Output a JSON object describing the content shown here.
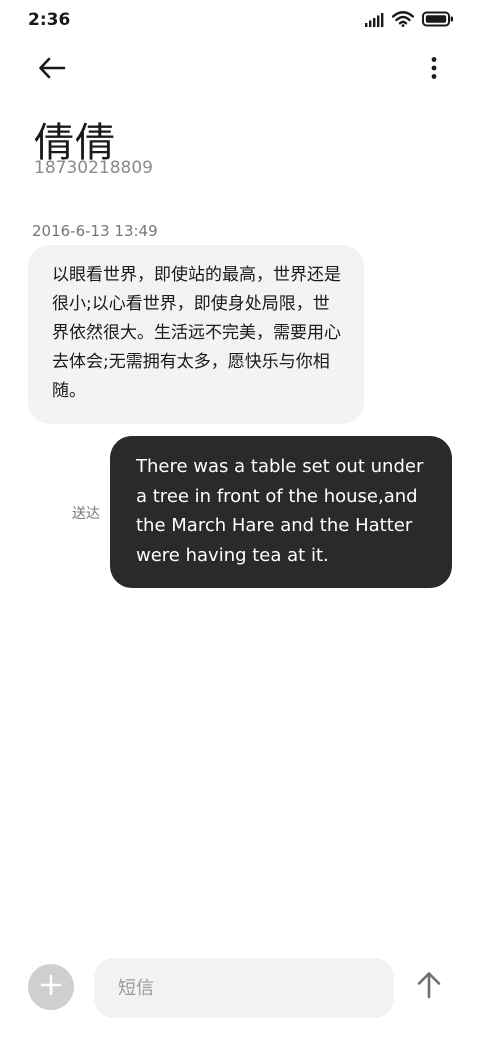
{
  "status_bar": {
    "time": "2:36",
    "icons": [
      "signal-icon",
      "wifi-icon",
      "battery-icon"
    ]
  },
  "header": {
    "back_icon": "arrow-left-icon",
    "more_icon": "more-vertical-icon",
    "contact_name": "倩倩",
    "contact_number": "18730218809"
  },
  "conversation": {
    "date": "2016-6-13 13:49",
    "messages": [
      {
        "direction": "incoming",
        "text": "以眼看世界，即使站的最高，世界还是很小;以心看世界，即使身处局限，世界依然很大。生活远不完美，需要用心去体会;无需拥有太多，愿快乐与你相随。"
      },
      {
        "direction": "outgoing",
        "text": "There was a table set out under a tree in front of the house,and the March Hare and the Hatter were having tea at it.",
        "status": "送达"
      }
    ]
  },
  "composer": {
    "attach_icon": "plus-icon",
    "placeholder": "短信",
    "value": "",
    "send_icon": "arrow-up-icon"
  },
  "colors": {
    "incoming_bubble": "#f3f3f3",
    "outgoing_bubble": "#2a2a2a",
    "secondary_text": "#8a8a8a"
  }
}
